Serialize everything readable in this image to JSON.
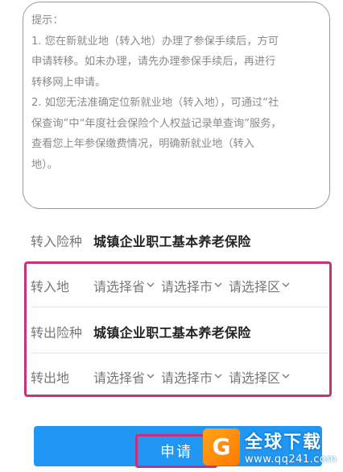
{
  "notice": {
    "title": "提示：",
    "lines": [
      "1. 您在新就业地（转入地）办理了参保手续后，方可",
      "申请转移。如未办理，请先办理参保手续后，再进行",
      "转移网上申请。",
      "2. 如您无法准确定位新就业地（转入地），可通过“社",
      "保查询”中“年度社会保险个人权益记录单查询”服务，",
      "查看您上年参保缴费情况，明确新就业地（转入",
      "地）。"
    ]
  },
  "transfer_in_type": {
    "label": "转入险种",
    "value": "城镇企业职工基本养老保险"
  },
  "transfer_in_place": {
    "label": "转入地",
    "province": "请选择省",
    "city": "请选择市",
    "district": "请选择区"
  },
  "transfer_out_type": {
    "label": "转出险种",
    "value": "城镇企业职工基本养老保险"
  },
  "transfer_out_place": {
    "label": "转出地",
    "province": "请选择省",
    "city": "请选择市",
    "district": "请选择区"
  },
  "apply_button": {
    "label": "申请"
  },
  "watermark": {
    "logo_glyph": "G",
    "title": "全球下载",
    "url": "www.qq241.com"
  },
  "colors": {
    "accent": "#2196f3",
    "highlight": "#c8327a"
  }
}
